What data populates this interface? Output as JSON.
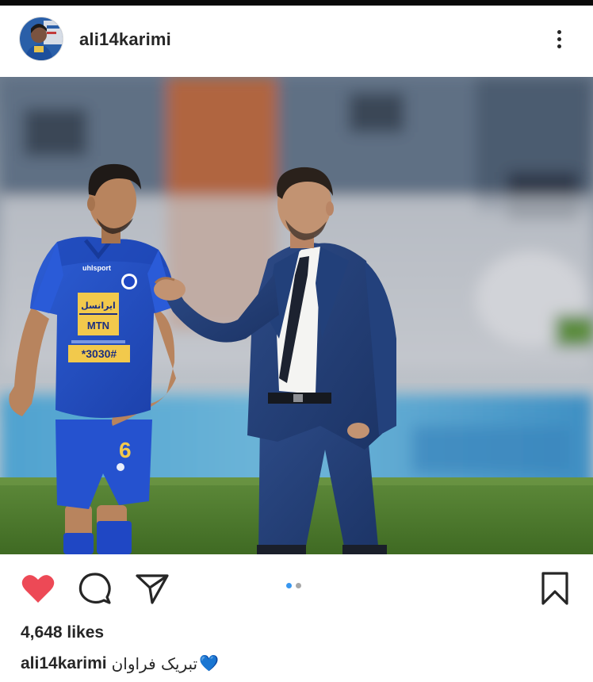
{
  "post": {
    "username": "ali14karimi",
    "likes_text": "4,648 likes",
    "caption_user": "ali14karimi",
    "caption_text": "تبریک فراوان",
    "caption_emoji": "💙",
    "liked": true,
    "carousel": {
      "count": 2,
      "active": 1
    }
  },
  "photo": {
    "jersey_sponsor": "ایرانسل",
    "jersey_brand": "MTN",
    "jersey_code": "*3030#",
    "kit_maker": "uhlsport",
    "player_number": "6"
  },
  "icons": {
    "heart": "heart-icon",
    "comment": "comment-icon",
    "share": "share-icon",
    "bookmark": "bookmark-icon",
    "more": "more-options-icon"
  },
  "colors": {
    "heart": "#ed4956",
    "dot_active": "#3897f0",
    "dot_inactive": "#a8a8a8",
    "text": "#262626"
  }
}
